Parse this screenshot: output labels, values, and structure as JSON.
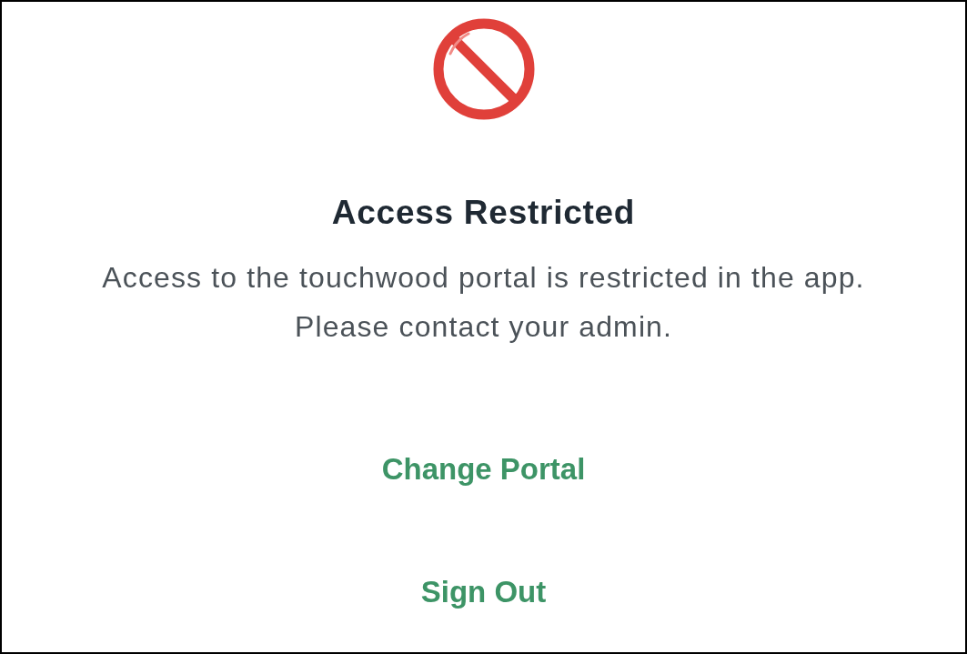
{
  "notice": {
    "title": "Access Restricted",
    "message_lines": [
      "Access to the touchwood portal is restricted in the app.",
      "Please contact your admin."
    ]
  },
  "actions": [
    {
      "label": "Change Portal"
    },
    {
      "label": "Sign Out"
    }
  ]
}
